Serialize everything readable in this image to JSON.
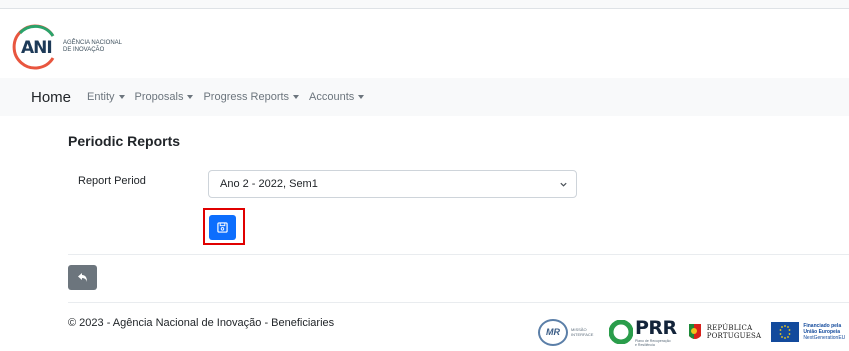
{
  "logo": {
    "mark_text": "ANI",
    "org_line1": "AGÊNCIA NACIONAL",
    "org_line2": "DE INOVAÇÃO"
  },
  "navbar": {
    "brand": "Home",
    "items": [
      {
        "label": "Entity"
      },
      {
        "label": "Proposals"
      },
      {
        "label": "Progress Reports"
      },
      {
        "label": "Accounts"
      }
    ]
  },
  "page": {
    "title": "Periodic Reports",
    "report_period_label": "Report Period",
    "report_period_value": "Ano 2 - 2022, Sem1"
  },
  "footer": {
    "copyright": "© 2023 - Agência Nacional de Inovação - Beneficiaries",
    "funding": {
      "mr_mark": "MR",
      "mr_text": "MISSÃO INTERFACE",
      "prr_word": "PRR",
      "prr_sub": "Plano de Recuperação e Resiliência",
      "rp_line1": "REPÚBLICA",
      "rp_line2": "PORTUGUESA",
      "eu_line1": "Financiado pela",
      "eu_line2": "União Europeia",
      "eu_line3": "NextGenerationEU"
    }
  },
  "colors": {
    "primary": "#0d6efd",
    "secondary": "#6c757d",
    "highlight": "#e00000",
    "navbar_bg": "#f8f9fa"
  },
  "icons": {
    "save": "save-icon",
    "back": "back-arrow-icon",
    "dropdown": "chevron-down-icon"
  }
}
